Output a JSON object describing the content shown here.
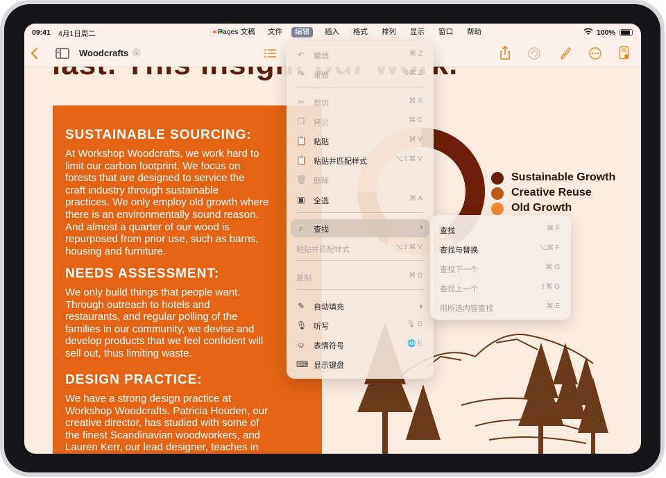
{
  "status_bar": {
    "time": "09:41",
    "date": "4月1日周二",
    "battery": "100%"
  },
  "menu_bar": {
    "items": [
      {
        "label": "Pages 文稿",
        "active": false
      },
      {
        "label": "文件",
        "active": false
      },
      {
        "label": "编辑",
        "active": true
      },
      {
        "label": "插入",
        "active": false
      },
      {
        "label": "格式",
        "active": false
      },
      {
        "label": "排列",
        "active": false
      },
      {
        "label": "显示",
        "active": false
      },
      {
        "label": "窗口",
        "active": false
      },
      {
        "label": "帮助",
        "active": false
      }
    ]
  },
  "toolbar": {
    "doc_title": "Woodcrafts",
    "icons": [
      "back-chevron-icon",
      "sidebar-icon",
      "list-icon",
      "share-icon",
      "undo-icon",
      "paintbrush-icon",
      "more-icon",
      "document-view-icon"
    ]
  },
  "document": {
    "background_heading": "last. This insight       our work.",
    "sections": [
      {
        "heading": "SUSTAINABLE SOURCING:",
        "body": "At Workshop Woodcrafts, we work hard to\nlimit our carbon footprint. We focus on\nforests that are designed to service the\ncraft industry through sustainable\npractices. We only employ old growth where\nthere is an environmentally sound reason.\nAnd almost a quarter of our wood is\nrepurposed from prior use, such as barns,\nhousing and furniture."
      },
      {
        "heading": "NEEDS ASSESSMENT:",
        "body": "We only build things that people want.\nThrough outreach to hotels and\nrestaurants, and regular polling of the\nfamilies in our community, we devise and\ndevelop products that we feel confident will\nsell out, thus limiting waste."
      },
      {
        "heading": "DESIGN PRACTICE:",
        "body": "We have a strong design practice at\nWorkshop Woodcrafts. Patricia Houden, our\ncreative director, has studied with some of\nthe finest Scandinavian woodworkers, and\nLauren Kerr, our lead designer, teaches in"
      }
    ],
    "legend": [
      {
        "label": "Sustainable Growth",
        "color": "#6e1e08"
      },
      {
        "label": "Creative Reuse",
        "color": "#c05a12"
      },
      {
        "label": "Old Growth",
        "color": "#f08a30"
      }
    ]
  },
  "edit_menu": {
    "items": [
      {
        "icon": "undo-icon",
        "label": "撤销",
        "shortcut": "⌘ Z",
        "disabled": true
      },
      {
        "icon": "redo-icon",
        "label": "重做",
        "shortcut": "⇧⌘ Z",
        "disabled": true
      },
      {
        "icon": "scissors-icon",
        "label": "剪切",
        "shortcut": "⌘ X",
        "disabled": true
      },
      {
        "icon": "copy-icon",
        "label": "拷贝",
        "shortcut": "⌘ C",
        "disabled": true
      },
      {
        "icon": "paste-icon",
        "label": "粘贴",
        "shortcut": "⌘ V",
        "disabled": false
      },
      {
        "icon": "paste-match-icon",
        "label": "粘贴并匹配样式",
        "shortcut": "⌥⇧⌘ V",
        "disabled": false
      },
      {
        "icon": "trash-icon",
        "label": "删除",
        "shortcut": "",
        "disabled": true
      },
      {
        "icon": "select-all-icon",
        "label": "全选",
        "shortcut": "⌘ A",
        "disabled": false
      },
      {
        "icon": "find-icon",
        "label": "查找",
        "shortcut": "›",
        "disabled": false
      },
      {
        "icon": "",
        "label": "粘贴并匹配样式",
        "shortcut": "⌥⇧⌘ V",
        "disabled": true
      },
      {
        "icon": "",
        "label": "复制",
        "shortcut": "⌘ D",
        "disabled": true
      },
      {
        "icon": "autofill-icon",
        "label": "自动填充",
        "shortcut": "›",
        "disabled": false
      },
      {
        "icon": "mic-icon",
        "label": "听写",
        "shortcut": "🎙 D",
        "disabled": false
      },
      {
        "icon": "emoji-icon",
        "label": "表情符号",
        "shortcut": "🌐 E",
        "disabled": false
      },
      {
        "icon": "keyboard-icon",
        "label": "显示键盘",
        "shortcut": "",
        "disabled": false
      }
    ]
  },
  "find_submenu": {
    "items": [
      {
        "label": "查找",
        "shortcut": "⌘ F",
        "disabled": false
      },
      {
        "label": "查找与替换",
        "shortcut": "⌥⌘ F",
        "disabled": false
      },
      {
        "label": "查找下一个",
        "shortcut": "⌘ G",
        "disabled": true
      },
      {
        "label": "查找上一个",
        "shortcut": "⇧⌘ G",
        "disabled": true
      },
      {
        "label": "用所选内容查找",
        "shortcut": "⌘ E",
        "disabled": true
      }
    ]
  }
}
